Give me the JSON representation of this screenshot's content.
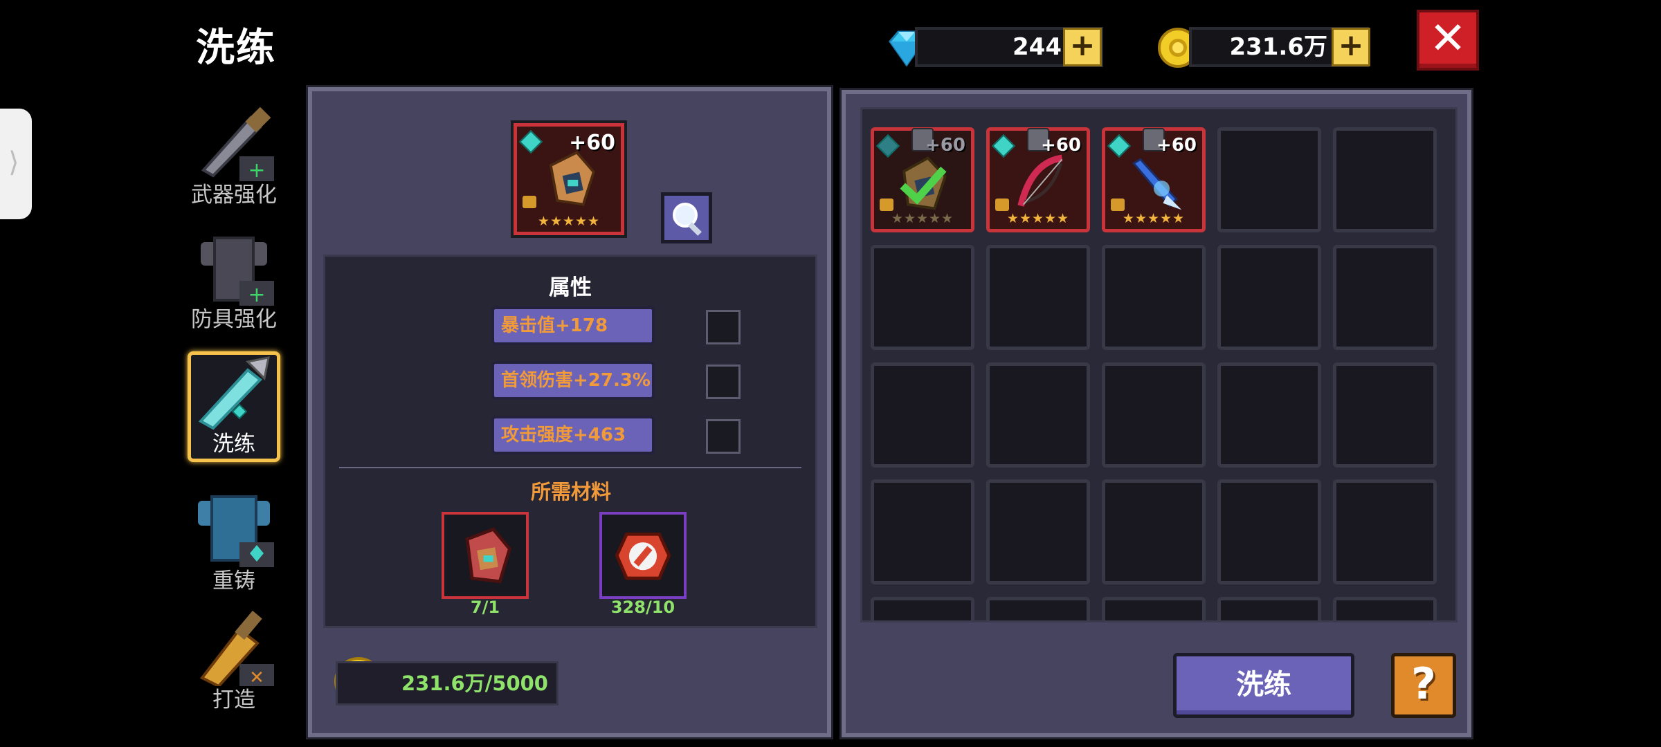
{
  "header": {
    "title": "洗练",
    "gems": "244",
    "gold": "231.6万",
    "add_symbol": "+",
    "close_symbol": "✕"
  },
  "side_menu": {
    "items": [
      {
        "label": "武器强化",
        "icon": "sword-upgrade-icon"
      },
      {
        "label": "防具强化",
        "icon": "armor-upgrade-icon"
      },
      {
        "label": "洗练",
        "icon": "crystal-sword-icon",
        "active": true
      },
      {
        "label": "重铸",
        "icon": "reforge-armor-icon"
      },
      {
        "label": "打造",
        "icon": "forge-icon"
      }
    ]
  },
  "equipment": {
    "level": "+60",
    "stars": "★★★★★"
  },
  "attributes": {
    "title": "属性",
    "items": [
      "暴击值+178",
      "首领伤害+27.3%",
      "攻击强度+463"
    ]
  },
  "materials": {
    "title": "所需材料",
    "items": [
      {
        "count": "7/1",
        "icon": "hood-material-icon",
        "border": "#c8343a"
      },
      {
        "count": "328/10",
        "icon": "reroll-stone-icon",
        "border": "#7a3fc0"
      }
    ]
  },
  "cost": {
    "value": "231.6万/5000"
  },
  "inventory": {
    "items": [
      {
        "level": "+60",
        "stars": "★★★★★",
        "icon": "hood-icon",
        "selected": true
      },
      {
        "level": "+60",
        "stars": "★★★★★",
        "icon": "red-bow-icon",
        "selected": false
      },
      {
        "level": "+60",
        "stars": "★★★★★",
        "icon": "ice-spear-icon",
        "selected": false
      }
    ]
  },
  "actions": {
    "reroll_label": "洗练",
    "help_label": "?"
  },
  "colors": {
    "accent_purple": "#6a63b8",
    "attr_text_orange": "#f19a3a",
    "count_green": "#8fe36b",
    "close_red": "#cf2027"
  }
}
